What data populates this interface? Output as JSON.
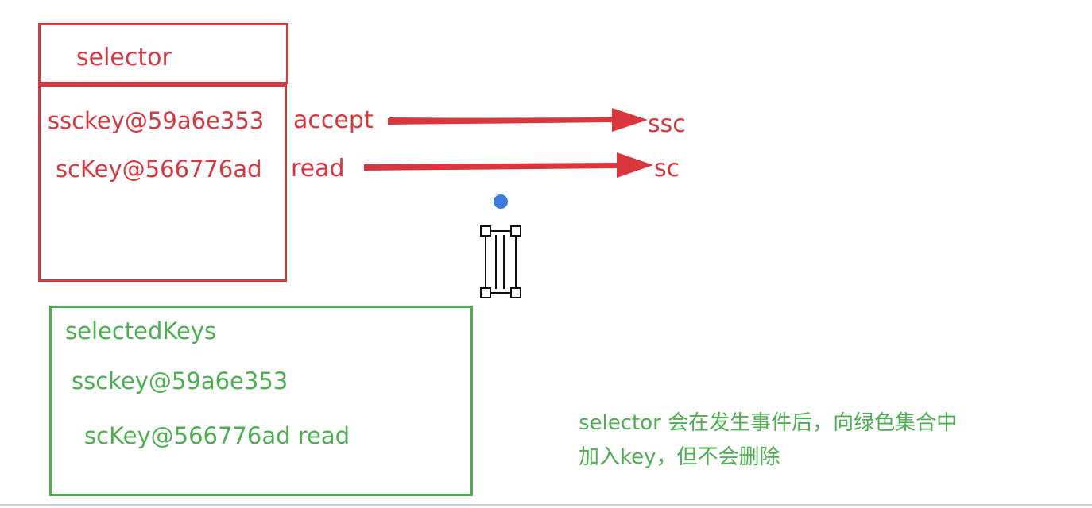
{
  "selector_box": {
    "title": "selector",
    "entries": [
      {
        "key": "ssckey@59a6e353",
        "event": "accept",
        "target": "ssc"
      },
      {
        "key": "scKey@566776ad",
        "event": "read",
        "target": "sc"
      }
    ]
  },
  "selected_keys_box": {
    "title": "selectedKeys",
    "entries": [
      "ssckey@59a6e353",
      "scKey@566776ad read"
    ]
  },
  "note": {
    "line1": "selector 会在发生事件后，向绿色集合中",
    "line2": "加入key，但不会删除"
  },
  "colors": {
    "red": "#d9363e",
    "green": "#4caf50",
    "dot": "#3b7be0"
  }
}
